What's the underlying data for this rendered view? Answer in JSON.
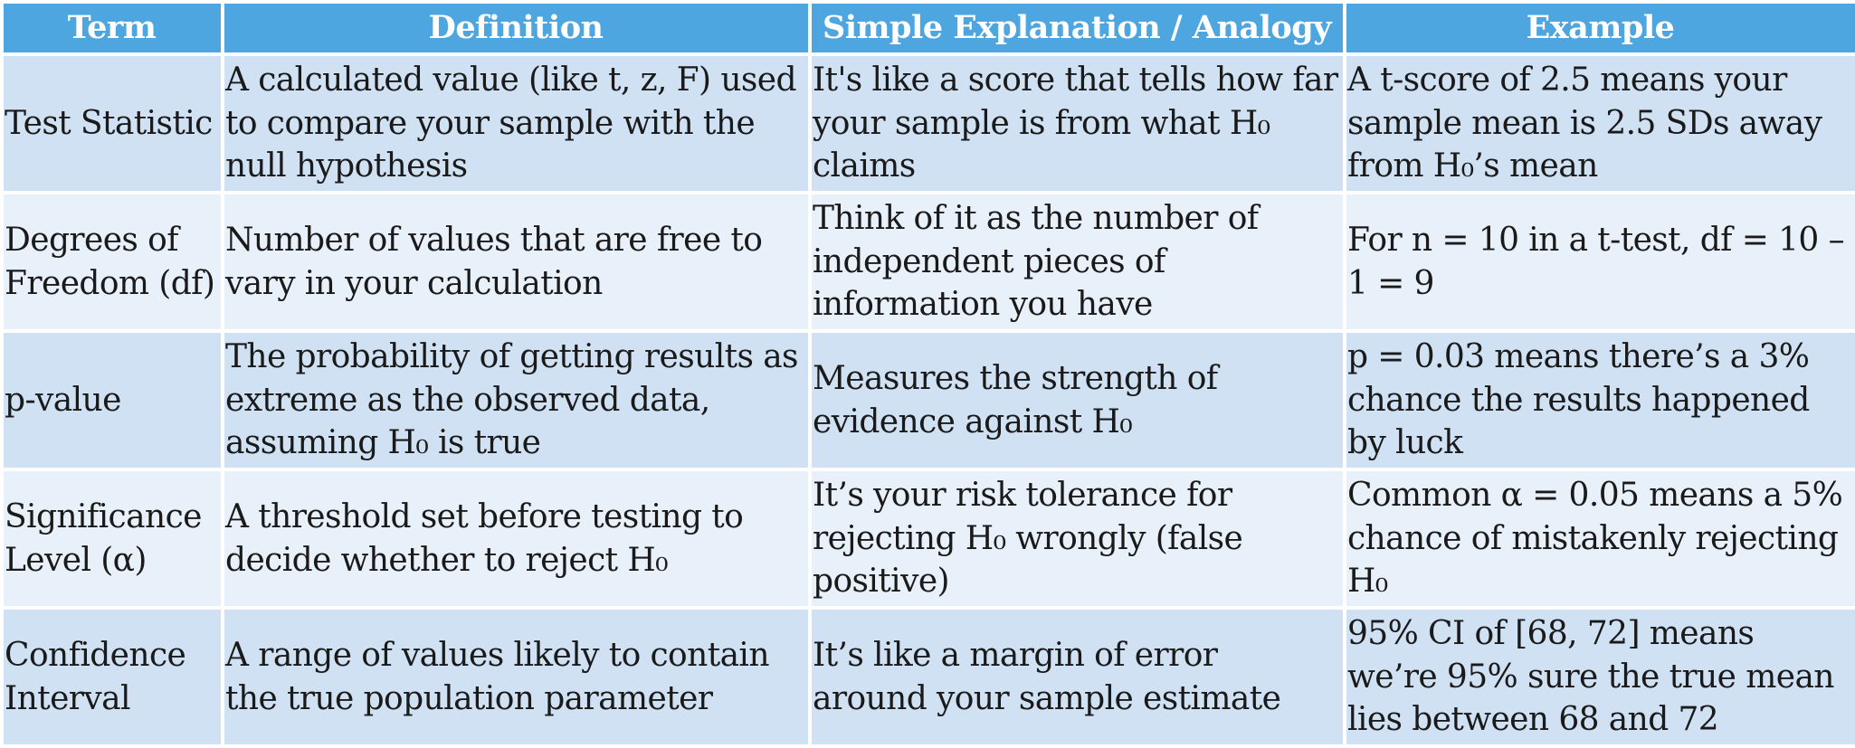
{
  "table": {
    "headers": [
      "Term",
      "Definition",
      "Simple Explanation / Analogy",
      "Example"
    ],
    "rows": [
      {
        "term": "Test Statistic",
        "definition": "A calculated value (like t, z, F) used to compare your sample with the null hypothesis",
        "explanation": "It's like a score that tells how far your sample is from what H₀ claims",
        "example": "A t-score of 2.5 means your sample mean is 2.5 SDs away from H₀’s mean"
      },
      {
        "term": "Degrees of Freedom (df)",
        "definition": "Number of values that are free to vary in your calculation",
        "explanation": "Think of it as the number of independent pieces of information you have",
        "example": "For n = 10 in a t-test, df = 10 – 1 = 9"
      },
      {
        "term": "p-value",
        "definition": "The probability of getting results as extreme as the observed data, assuming H₀ is true",
        "explanation": "Measures the strength of evidence against H₀",
        "example": "p = 0.03 means there’s a 3% chance the results happened by luck"
      },
      {
        "term": "Significance Level (α)",
        "definition": "A threshold set before testing to decide whether to reject H₀",
        "explanation": "It’s your risk tolerance for rejecting H₀ wrongly (false positive)",
        "example": "Common α = 0.05 means a 5% chance of mistakenly rejecting H₀"
      },
      {
        "term": "Confidence Interval",
        "definition": "A range of values likely to contain the true population parameter",
        "explanation": "It’s like a margin of error around your sample estimate",
        "example": "95% CI of [68, 72] means we’re 95% sure the true mean lies between 68 and 72"
      }
    ]
  },
  "colors": {
    "header": "#4da6e0",
    "row_dark": "#cfe1f3",
    "row_light": "#e8f1fa",
    "border": "#ffffff",
    "text": "#1a1a1a"
  }
}
